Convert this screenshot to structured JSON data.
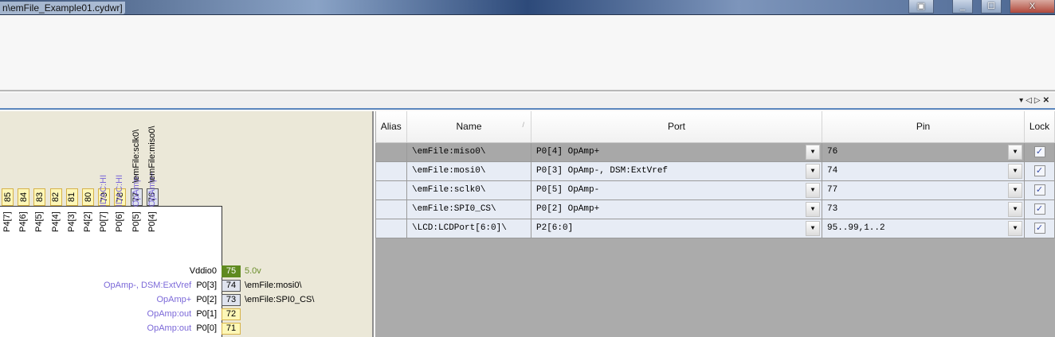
{
  "window": {
    "title": "n\\emFile_Example01.cydwr]",
    "buttons": [
      "▣",
      "_",
      "☐",
      "X"
    ]
  },
  "panel": {
    "controls": [
      "▾",
      "◁",
      "▷",
      "✕"
    ]
  },
  "diagram": {
    "top_pins": [
      {
        "num": "85",
        "port": "P4[7]",
        "func": "",
        "signal": "",
        "assigned": false
      },
      {
        "num": "84",
        "port": "P4[6]",
        "func": "",
        "signal": "",
        "assigned": false
      },
      {
        "num": "83",
        "port": "P4[5]",
        "func": "",
        "signal": "",
        "assigned": false
      },
      {
        "num": "82",
        "port": "P4[4]",
        "func": "",
        "signal": "",
        "assigned": false
      },
      {
        "num": "81",
        "port": "P4[3]",
        "func": "",
        "signal": "",
        "assigned": false
      },
      {
        "num": "80",
        "port": "P4[2]",
        "func": "",
        "signal": "",
        "assigned": false
      },
      {
        "num": "79",
        "port": "P0[7]",
        "func": "IDAC:HI",
        "signal": "",
        "assigned": false
      },
      {
        "num": "78",
        "port": "P0[6]",
        "func": "IDAC:HI",
        "signal": "",
        "assigned": false
      },
      {
        "num": "77",
        "port": "P0[5]",
        "func": "OpAmp-",
        "signal": "\\emFile:sclk0\\",
        "assigned": true
      },
      {
        "num": "76",
        "port": "P0[4]",
        "func": "OpAmp+",
        "signal": "\\emFile:miso0\\",
        "assigned": true
      }
    ],
    "right_pins": [
      {
        "num": "75",
        "port": "Vddio0",
        "func": "",
        "signal": "5.0v",
        "kind": "power"
      },
      {
        "num": "74",
        "port": "P0[3]",
        "func": "OpAmp-, DSM:ExtVref",
        "signal": "\\emFile:mosi0\\",
        "kind": "assigned"
      },
      {
        "num": "73",
        "port": "P0[2]",
        "func": "OpAmp+",
        "signal": "\\emFile:SPI0_CS\\",
        "kind": "assigned"
      },
      {
        "num": "72",
        "port": "P0[1]",
        "func": "OpAmp:out",
        "signal": "",
        "kind": "free"
      },
      {
        "num": "71",
        "port": "P0[0]",
        "func": "OpAmp:out",
        "signal": "",
        "kind": "free"
      }
    ]
  },
  "table": {
    "headers": {
      "alias": "Alias",
      "name": "Name",
      "port": "Port",
      "pin": "Pin",
      "lock": "Lock"
    },
    "sort_indicator": "/",
    "rows": [
      {
        "alias": "",
        "name": "\\emFile:miso0\\",
        "port": "P0[4] OpAmp+",
        "pin": "76",
        "lock": true
      },
      {
        "alias": "",
        "name": "\\emFile:mosi0\\",
        "port": "P0[3] OpAmp-, DSM:ExtVref",
        "pin": "74",
        "lock": true
      },
      {
        "alias": "",
        "name": "\\emFile:sclk0\\",
        "port": "P0[5] OpAmp-",
        "pin": "77",
        "lock": true
      },
      {
        "alias": "",
        "name": "\\emFile:SPI0_CS\\",
        "port": "P0[2] OpAmp+",
        "pin": "73",
        "lock": true
      },
      {
        "alias": "",
        "name": "\\LCD:LCDPort[6:0]\\",
        "port": "P2[6:0]",
        "pin": "95..99,1..2",
        "lock": true
      }
    ]
  }
}
